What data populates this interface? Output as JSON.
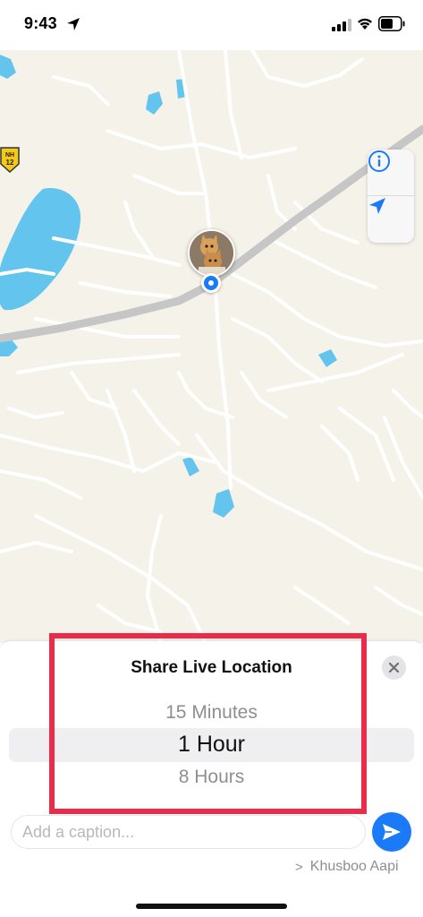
{
  "status_bar": {
    "time": "9:43",
    "icons": [
      "location-arrow-icon",
      "cellular-signal-icon",
      "wifi-icon",
      "battery-icon"
    ]
  },
  "map": {
    "controls": [
      "info-icon",
      "location-arrow-icon"
    ],
    "highway_shield": {
      "line1": "NH",
      "line2": "12"
    },
    "colors": {
      "land": "#f5f2ea",
      "water": "#63c5ee",
      "road": "#ffffff",
      "highway": "#c6c6c6",
      "accent": "#1a7af8"
    }
  },
  "sheet": {
    "title": "Share Live Location",
    "picker": {
      "options": [
        "15 Minutes",
        "1 Hour",
        "8 Hours"
      ],
      "selected": "1 Hour"
    },
    "caption_placeholder": "Add a caption...",
    "recipient_chevron": ">",
    "recipient_name": "Khusboo Aapi"
  },
  "highlight_color": "#ec2a4a"
}
